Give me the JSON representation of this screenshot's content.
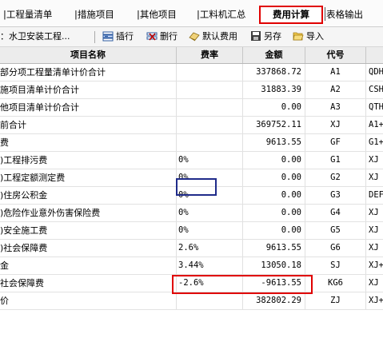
{
  "tabs": [
    {
      "label": "|工程量清单"
    },
    {
      "label": "|措施项目"
    },
    {
      "label": "|其他项目"
    },
    {
      "label": "|工料机汇总"
    },
    {
      "label": "费用计算",
      "active": true
    },
    {
      "label": "表格输出"
    }
  ],
  "toolbar": {
    "project_label": "：水卫安装工程...",
    "insert_label": "插行",
    "delete_label": "删行",
    "default_fee_label": "默认费用",
    "save_as_label": "另存",
    "import_label": "导入"
  },
  "columns": {
    "name": "项目名称",
    "rate": "费率",
    "amount": "金额",
    "code": "代号"
  },
  "rows": [
    {
      "name": "部分项工程量清单计价合计",
      "rate": "",
      "amount": "337868.72",
      "code": "A1",
      "extra": "QDH"
    },
    {
      "name": "施项目清单计价合计",
      "rate": "",
      "amount": "31883.39",
      "code": "A2",
      "extra": "CSH"
    },
    {
      "name": "他项目清单计价合计",
      "rate": "",
      "amount": "0.00",
      "code": "A3",
      "extra": "QTH"
    },
    {
      "name": "前合计",
      "rate": "",
      "amount": "369752.11",
      "code": "XJ",
      "extra": "A1+"
    },
    {
      "name": "费",
      "rate": "",
      "amount": "9613.55",
      "code": "GF",
      "extra": "G1+"
    },
    {
      "name": ")工程排污费",
      "rate": "0%",
      "amount": "0.00",
      "code": "G1",
      "extra": "XJ"
    },
    {
      "name": ")工程定额测定费",
      "rate": "0%",
      "amount": "0.00",
      "code": "G2",
      "extra": "XJ"
    },
    {
      "name": ")住房公积金",
      "rate": "0%",
      "amount": "0.00",
      "code": "G3",
      "extra": "DEF"
    },
    {
      "name": ")危险作业意外伤害保险费",
      "rate": "0%",
      "amount": "0.00",
      "code": "G4",
      "extra": "XJ"
    },
    {
      "name": ")安全施工费",
      "rate": "0%",
      "amount": "0.00",
      "code": "G5",
      "extra": "XJ"
    },
    {
      "name": ")社会保障费",
      "rate": "2.6%",
      "amount": "9613.55",
      "code": "G6",
      "extra": "XJ"
    },
    {
      "name": "金",
      "rate": "3.44%",
      "amount": "13050.18",
      "code": "SJ",
      "extra": "XJ+"
    },
    {
      "name": "社会保障费",
      "rate": "-2.6%",
      "amount": "-9613.55",
      "code": "KG6",
      "extra": "XJ"
    },
    {
      "name": "价",
      "rate": "",
      "amount": "382802.29",
      "code": "ZJ",
      "extra": "XJ+"
    }
  ],
  "colors": {
    "highlight_red": "#e00000",
    "focus_blue": "#1f2b8a"
  }
}
